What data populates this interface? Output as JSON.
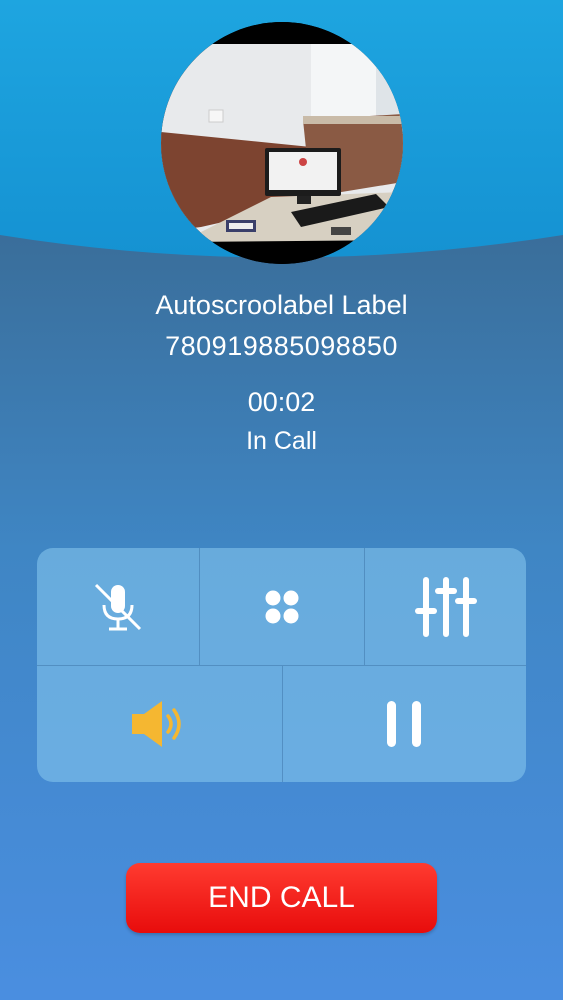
{
  "caller": {
    "name": "Autoscroolabel Label",
    "number": "780919885098850"
  },
  "call": {
    "timer": "00:02",
    "status": "In Call"
  },
  "controls": {
    "row1": [
      "mute-icon",
      "keypad-icon",
      "equalizer-icon"
    ],
    "row2": [
      "speaker-icon",
      "pause-icon"
    ]
  },
  "end_call": {
    "label": "END CALL"
  },
  "colors": {
    "header_blue": "#1ea0dc",
    "end_call_red": "#ff1e1e",
    "speaker_active": "#f5b731"
  }
}
